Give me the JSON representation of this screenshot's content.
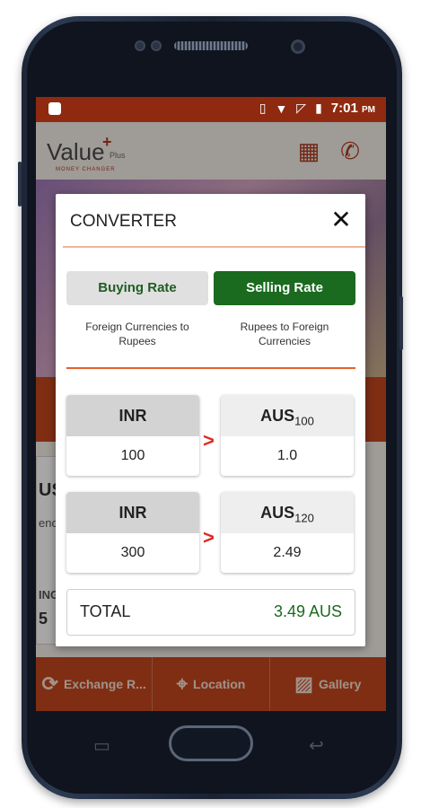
{
  "status_bar": {
    "time": "7:01",
    "ampm": "PM"
  },
  "app": {
    "logo": "Value",
    "logo_plus": "+",
    "logo_sub": "Plus",
    "logo_tag": "MONEY CHANGER"
  },
  "background": {
    "card_code": "US",
    "card_text": "enc",
    "card_label": "ING",
    "card_value": "5"
  },
  "bottom_nav": [
    {
      "label": "Exchange R...",
      "icon": "exchange-rate-icon"
    },
    {
      "label": "Location",
      "icon": "location-pin-icon"
    },
    {
      "label": "Gallery",
      "icon": "gallery-icon"
    }
  ],
  "dialog": {
    "title": "CONVERTER",
    "close_glyph": "✕",
    "buying": {
      "label": "Buying Rate",
      "desc": "Foreign Currencies to Rupees"
    },
    "selling": {
      "label": "Selling Rate",
      "desc": "Rupees to Foreign Currencies",
      "selected": true
    },
    "rows": [
      {
        "from_code": "INR",
        "from_value": "100",
        "to_code": "AUS",
        "to_sub": "100",
        "to_value": "1.0"
      },
      {
        "from_code": "INR",
        "from_value": "300",
        "to_code": "AUS",
        "to_sub": "120",
        "to_value": "2.49"
      }
    ],
    "arrow_glyph": ">",
    "total_label": "TOTAL",
    "total_value": "3.49 AUS"
  },
  "colors": {
    "brand": "#c3471e",
    "status_bar": "#8f2a10",
    "selected_green": "#1a6a1f",
    "arrow_red": "#e02a1f"
  }
}
